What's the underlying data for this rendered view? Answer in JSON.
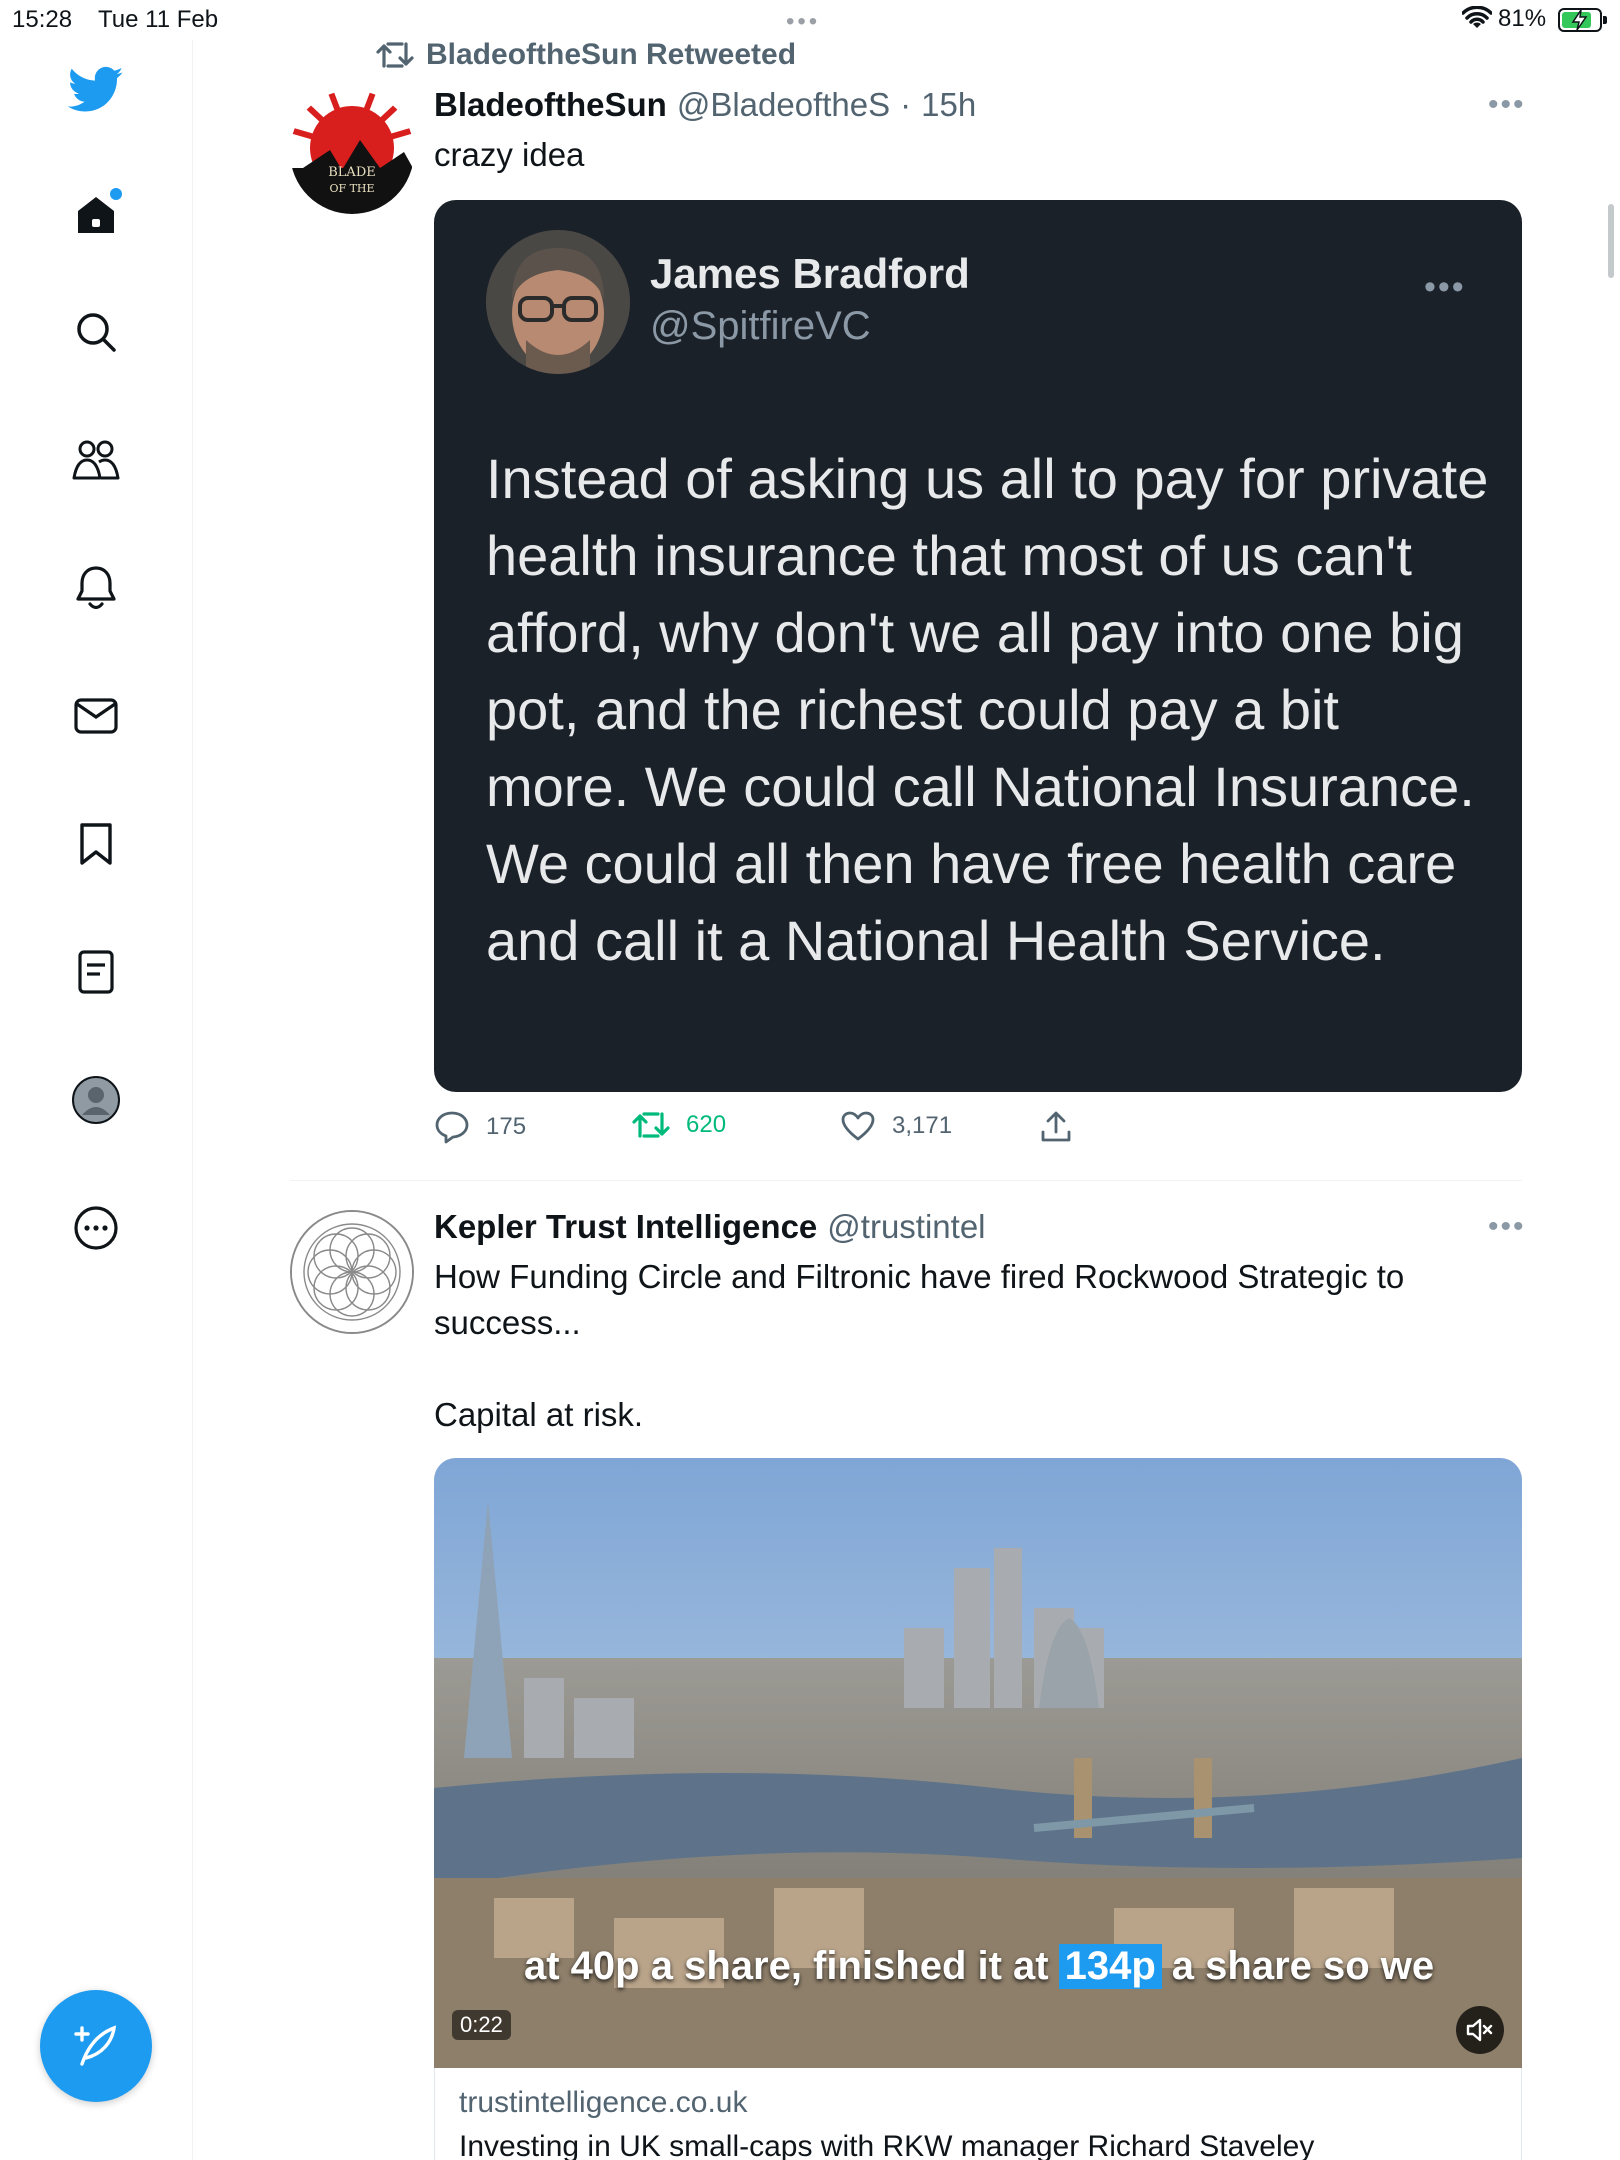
{
  "status_bar": {
    "time": "15:28",
    "date": "Tue 11 Feb",
    "battery_percent": "81%",
    "battery_level": 0.81,
    "battery_charging": true
  },
  "nav": {
    "items": [
      {
        "name": "twitter-logo",
        "icon": "bird-icon"
      },
      {
        "name": "home",
        "icon": "home-icon",
        "has_notification_dot": true
      },
      {
        "name": "explore",
        "icon": "search-icon"
      },
      {
        "name": "communities",
        "icon": "people-icon"
      },
      {
        "name": "notifications",
        "icon": "bell-icon"
      },
      {
        "name": "messages",
        "icon": "mail-icon"
      },
      {
        "name": "bookmarks",
        "icon": "bookmark-icon"
      },
      {
        "name": "lists",
        "icon": "list-icon"
      },
      {
        "name": "profile",
        "icon": "avatar-icon"
      },
      {
        "name": "more",
        "icon": "more-circle-icon"
      }
    ],
    "compose_icon": "compose-feather-icon"
  },
  "tweet1": {
    "retweeted_by": "BladeoftheSun Retweeted",
    "author_name": "BladeoftheSun",
    "author_handle": "@BladeoftheS",
    "separator": "·",
    "time": "15h",
    "text": "crazy idea",
    "avatar_text": "BLADE OF THE",
    "quote": {
      "name": "James Bradford",
      "handle": "@SpitfireVC",
      "text": "Instead of asking us all to pay for private health insurance that most of us can't afford, why don't we all pay into one big pot, and the richest could pay a bit more. We could call National Insurance. We could all then have free health care and call it a National Health Service."
    },
    "replies": "175",
    "retweets": "620",
    "likes": "3,171"
  },
  "tweet2": {
    "author_name": "Kepler Trust Intelligence",
    "author_handle": "@trustintel",
    "text_line1": "How Funding Circle and Filtronic have fired Rockwood Strategic to success...",
    "text_line2": "Capital at risk.",
    "video": {
      "caption_before": "at 40p a share, finished it at",
      "caption_highlight": "134p",
      "caption_after": "a share so we",
      "duration": "0:22"
    },
    "link": {
      "domain": "trustintelligence.co.uk",
      "title": "Investing in UK small-caps with RKW manager Richard Staveley"
    }
  },
  "colors": {
    "accent": "#1d9bf0",
    "retweet_green": "#00ba7c",
    "quote_bg": "#1b2129",
    "muted_text": "#536471"
  }
}
